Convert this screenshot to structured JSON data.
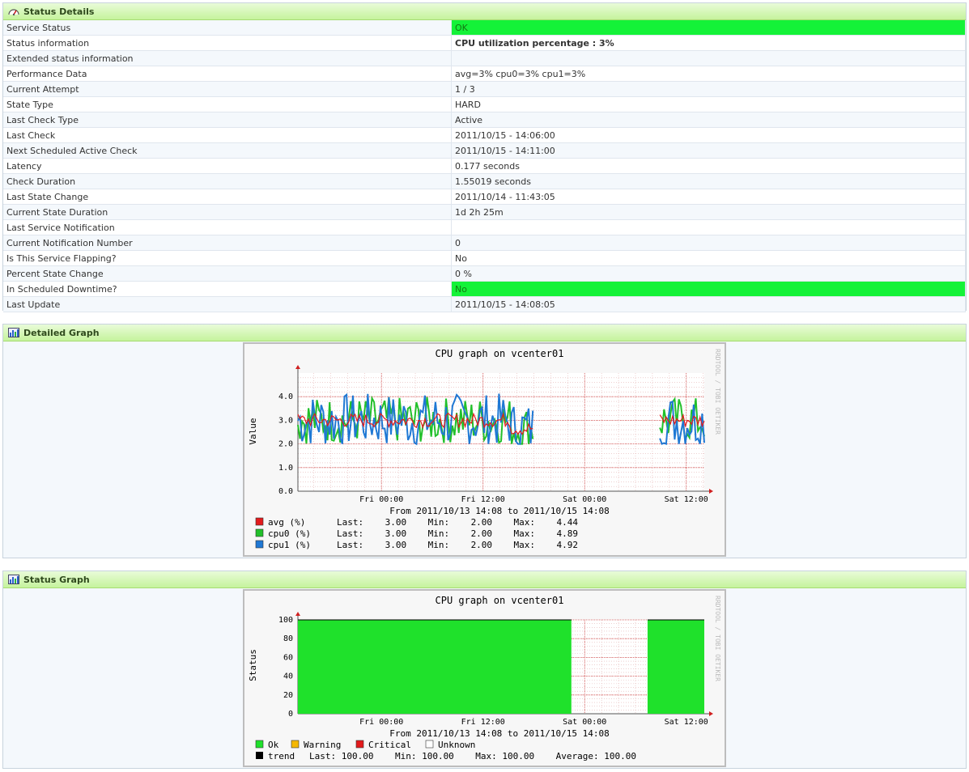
{
  "status_details": {
    "title": "Status Details",
    "rows": [
      {
        "label": "Service Status",
        "value": "OK",
        "highlight": "green"
      },
      {
        "label": "Status information",
        "value": "CPU utilization percentage : 3%",
        "bold": true
      },
      {
        "label": "Extended status information",
        "value": ""
      },
      {
        "label": "Performance Data",
        "value": "avg=3% cpu0=3% cpu1=3%"
      },
      {
        "label": "Current Attempt",
        "value": "1 / 3"
      },
      {
        "label": "State Type",
        "value": "HARD"
      },
      {
        "label": "Last Check Type",
        "value": "Active"
      },
      {
        "label": "Last Check",
        "value": "2011/10/15 - 14:06:00"
      },
      {
        "label": "Next Scheduled Active Check",
        "value": "2011/10/15 - 14:11:00"
      },
      {
        "label": "Latency",
        "value": "0.177 seconds"
      },
      {
        "label": "Check Duration",
        "value": "1.55019 seconds"
      },
      {
        "label": "Last State Change",
        "value": "2011/10/14 - 11:43:05"
      },
      {
        "label": "Current State Duration",
        "value": "1d 2h 25m"
      },
      {
        "label": "Last Service Notification",
        "value": ""
      },
      {
        "label": "Current Notification Number",
        "value": "0"
      },
      {
        "label": "Is This Service Flapping?",
        "value": "No"
      },
      {
        "label": "Percent State Change",
        "value": "0 %"
      },
      {
        "label": "In Scheduled Downtime?",
        "value": "No",
        "highlight": "green"
      },
      {
        "label": "Last Update",
        "value": "2011/10/15 - 14:08:05"
      }
    ]
  },
  "detailed_graph": {
    "title": "Detailed Graph",
    "watermark": "RRDTOOL / TOBI OETIKER",
    "legend": [
      {
        "name": "avg (%)",
        "color": "#e31a1c",
        "text": "Last:    3.00    Min:    2.00    Max:    4.44"
      },
      {
        "name": "cpu0 (%)",
        "color": "#22c02a",
        "text": "Last:    3.00    Min:    2.00    Max:    4.89"
      },
      {
        "name": "cpu1 (%)",
        "color": "#1f78d4",
        "text": "Last:    3.00    Min:    2.00    Max:    4.92"
      }
    ]
  },
  "status_graph": {
    "title": "Status Graph",
    "watermark": "RRDTOOL / TOBI OETIKER",
    "legend_states": [
      {
        "name": "Ok",
        "color": "#1fe12b"
      },
      {
        "name": "Warning",
        "color": "#f5b800"
      },
      {
        "name": "Critical",
        "color": "#e31a1c"
      },
      {
        "name": "Unknown",
        "color": "#ffffff"
      }
    ],
    "trend": {
      "name": "trend",
      "color": "#000000",
      "text": "Last: 100.00    Min: 100.00    Max: 100.00    Average: 100.00"
    }
  },
  "chart_data": [
    {
      "type": "line",
      "title": "CPU graph on vcenter01",
      "subtitle": "From 2011/10/13 14:08 to 2011/10/15 14:08",
      "ylabel": "Value",
      "xlabel": "",
      "x_range": [
        "2011/10/13 14:08",
        "2011/10/15 14:08"
      ],
      "x_ticks": [
        "Fri 00:00",
        "Fri 12:00",
        "Sat 00:00",
        "Sat 12:00"
      ],
      "x_tick_hours": [
        9.87,
        21.87,
        33.87,
        45.87
      ],
      "ylim": [
        0,
        5
      ],
      "y_ticks": [
        0.0,
        1.0,
        2.0,
        3.0,
        4.0
      ],
      "grid": true,
      "data_gap_hours": [
        27.8,
        42.6
      ],
      "series": [
        {
          "name": "avg (%)",
          "last": 3.0,
          "min": 2.0,
          "max": 4.44
        },
        {
          "name": "cpu0 (%)",
          "last": 3.0,
          "min": 2.0,
          "max": 4.89
        },
        {
          "name": "cpu1 (%)",
          "last": 3.0,
          "min": 2.0,
          "max": 4.92
        }
      ]
    },
    {
      "type": "area",
      "title": "CPU graph on vcenter01",
      "subtitle": "From 2011/10/13 14:08 to 2011/10/15 14:08",
      "ylabel": "Status",
      "xlabel": "",
      "x_ticks": [
        "Fri 00:00",
        "Fri 12:00",
        "Sat 00:00",
        "Sat 12:00"
      ],
      "x_tick_hours": [
        9.87,
        21.87,
        33.87,
        45.87
      ],
      "ylim": [
        0,
        100
      ],
      "y_ticks": [
        0,
        20,
        40,
        60,
        80,
        100
      ],
      "grid": true,
      "series": [
        {
          "name": "Ok",
          "segments": [
            {
              "from_hour": 0,
              "to_hour": 32.3,
              "value": 100
            },
            {
              "from_hour": 41.3,
              "to_hour": 48,
              "value": 100
            }
          ]
        }
      ]
    }
  ]
}
